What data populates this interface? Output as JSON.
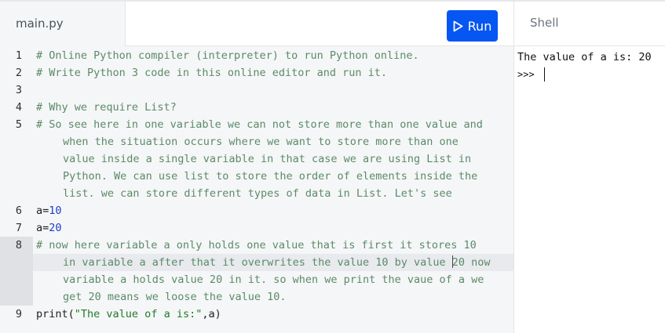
{
  "tabs": {
    "file_name": "main.py"
  },
  "toolbar": {
    "run_label": "Run"
  },
  "shell": {
    "title": "Shell",
    "output": "The value of a is: 20",
    "prompt": ">>>"
  },
  "editor": {
    "line_numbers": [
      "1",
      "2",
      "3",
      "4",
      "5",
      "6",
      "7",
      "8",
      "9"
    ],
    "active_line": "8",
    "lines": {
      "l1": "# Online Python compiler (interpreter) to run Python online.",
      "l2": "# Write Python 3 code in this online editor and run it.",
      "l4": "# Why we require List?",
      "l5a": "# So see here in one variable we can not store more than one value and",
      "l5b": "when the situation occurs where we want to store more than one",
      "l5c": "value inside a single variable in that case we are using List in",
      "l5d": "Python. We can use list to store the order of elements inside the",
      "l5e": "list. we can store different types of data in List. Let's see",
      "l6_var": "a",
      "l6_op": "=",
      "l6_num": "10",
      "l7_var": "a",
      "l7_op": "=",
      "l7_num": "20",
      "l8a": "# now here variable a only holds one value that is first it stores 10",
      "l8b_pre": "in variable a after that it overwrites the value 10 by value ",
      "l8b_post": "20 now",
      "l8c": "variable a holds value 20 in it. so when we print the vaue of a we",
      "l8d": "get 20 means we loose the value 10.",
      "l9_fn": "print",
      "l9_open": "(",
      "l9_str": "\"The value of a is:\"",
      "l9_rest": ",a)"
    }
  }
}
